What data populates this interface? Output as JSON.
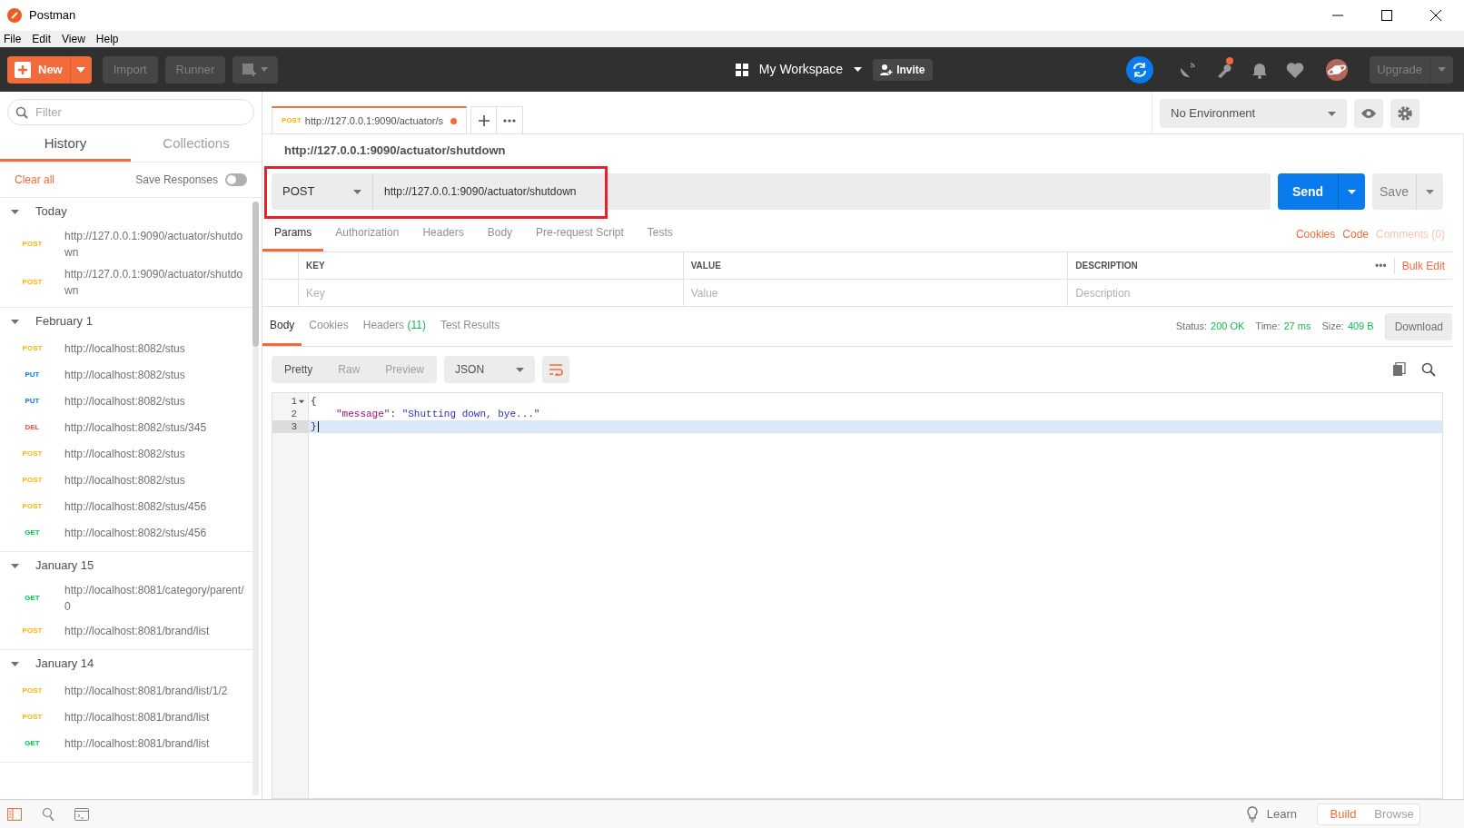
{
  "window": {
    "title": "Postman"
  },
  "menu": [
    "File",
    "Edit",
    "View",
    "Help"
  ],
  "toolbar": {
    "new_label": "New",
    "import_label": "Import",
    "runner_label": "Runner",
    "workspace": "My Workspace",
    "invite": "Invite",
    "upgrade": "Upgrade",
    "notification_dot": true
  },
  "sidebar": {
    "filter_placeholder": "Filter",
    "tabs": [
      {
        "label": "History",
        "selected": true
      },
      {
        "label": "Collections",
        "selected": false
      }
    ],
    "clear_all": "Clear all",
    "save_responses": {
      "label": "Save Responses",
      "on": false
    },
    "groups": [
      {
        "title": "Today",
        "expanded": true,
        "items": [
          {
            "method": "POST",
            "color": "#ffb400",
            "url": "http://127.0.0.1:9090/actuator/shutdown"
          },
          {
            "method": "POST",
            "color": "#ffb400",
            "url": "http://127.0.0.1:9090/actuator/shutdown"
          }
        ]
      },
      {
        "title": "February 1",
        "expanded": true,
        "items": [
          {
            "method": "POST",
            "color": "#ffb400",
            "url": "http://localhost:8082/stus"
          },
          {
            "method": "PUT",
            "color": "#097bed",
            "url": "http://localhost:8082/stus"
          },
          {
            "method": "PUT",
            "color": "#097bed",
            "url": "http://localhost:8082/stus"
          },
          {
            "method": "DEL",
            "color": "#ed4b48",
            "url": "http://localhost:8082/stus/345"
          },
          {
            "method": "POST",
            "color": "#ffb400",
            "url": "http://localhost:8082/stus"
          },
          {
            "method": "POST",
            "color": "#ffb400",
            "url": "http://localhost:8082/stus"
          },
          {
            "method": "POST",
            "color": "#ffb400",
            "url": "http://localhost:8082/stus/456"
          },
          {
            "method": "GET",
            "color": "#0cbb52",
            "url": "http://localhost:8082/stus/456"
          }
        ]
      },
      {
        "title": "January 15",
        "expanded": true,
        "items": [
          {
            "method": "GET",
            "color": "#0cbb52",
            "url": "http://localhost:8081/category/parent/0"
          },
          {
            "method": "POST",
            "color": "#ffb400",
            "url": "http://localhost:8081/brand/list"
          }
        ]
      },
      {
        "title": "January 14",
        "expanded": true,
        "items": [
          {
            "method": "POST",
            "color": "#ffb400",
            "url": "http://localhost:8081/brand/list/1/2"
          },
          {
            "method": "POST",
            "color": "#ffb400",
            "url": "http://localhost:8081/brand/list"
          },
          {
            "method": "GET",
            "color": "#0cbb52",
            "url": "http://localhost:8081/brand/list"
          }
        ]
      }
    ]
  },
  "request_tabs": [
    {
      "method": "POST",
      "title": "http://127.0.0.1:9090/actuator/s",
      "unsaved": true,
      "selected": true
    }
  ],
  "environment": "No Environment",
  "request": {
    "title": "http://127.0.0.1:9090/actuator/shutdown",
    "method": "POST",
    "url": "http://127.0.0.1:9090/actuator/shutdown",
    "highlighted": true,
    "send": "Send",
    "save": "Save",
    "tabs": [
      {
        "label": "Params",
        "selected": true
      },
      {
        "label": "Authorization",
        "selected": false
      },
      {
        "label": "Headers",
        "selected": false
      },
      {
        "label": "Body",
        "selected": false
      },
      {
        "label": "Pre-request Script",
        "selected": false
      },
      {
        "label": "Tests",
        "selected": false
      }
    ],
    "links": [
      {
        "label": "Cookies",
        "disabled": false
      },
      {
        "label": "Code",
        "disabled": false
      },
      {
        "label": "Comments (0)",
        "disabled": true
      }
    ],
    "params": {
      "columns": [
        "KEY",
        "VALUE",
        "DESCRIPTION"
      ],
      "more": "•••",
      "bulk_edit": "Bulk Edit",
      "placeholders": [
        "Key",
        "Value",
        "Description"
      ]
    }
  },
  "response": {
    "tabs": [
      {
        "label": "Body",
        "selected": true
      },
      {
        "label": "Cookies",
        "selected": false
      },
      {
        "label": "Headers",
        "count": "(11)",
        "selected": false
      },
      {
        "label": "Test Results",
        "selected": false
      }
    ],
    "stats": [
      {
        "label": "Status:",
        "value": "200 OK"
      },
      {
        "label": "Time:",
        "value": "27 ms"
      },
      {
        "label": "Size:",
        "value": "409 B"
      }
    ],
    "download": "Download",
    "views": [
      {
        "label": "Pretty",
        "selected": true
      },
      {
        "label": "Raw",
        "selected": false
      },
      {
        "label": "Preview",
        "selected": false
      }
    ],
    "format": "JSON",
    "lines": [
      {
        "number": "1",
        "foldable": true,
        "active": false,
        "tokens": [
          {
            "kind": "punct",
            "text": "{"
          }
        ]
      },
      {
        "number": "2",
        "foldable": false,
        "active": false,
        "tokens": [
          {
            "kind": "key",
            "text": "\"message\""
          },
          {
            "kind": "punct",
            "text": ": "
          },
          {
            "kind": "string",
            "text": "\"Shutting down, bye...\""
          }
        ]
      },
      {
        "number": "3",
        "foldable": false,
        "active": true,
        "tokens": [
          {
            "kind": "punct",
            "text": "}"
          }
        ]
      }
    ]
  },
  "status_bar": {
    "learn": "Learn",
    "modes": [
      {
        "label": "Build",
        "selected": true
      },
      {
        "label": "Browse",
        "selected": false
      }
    ]
  }
}
